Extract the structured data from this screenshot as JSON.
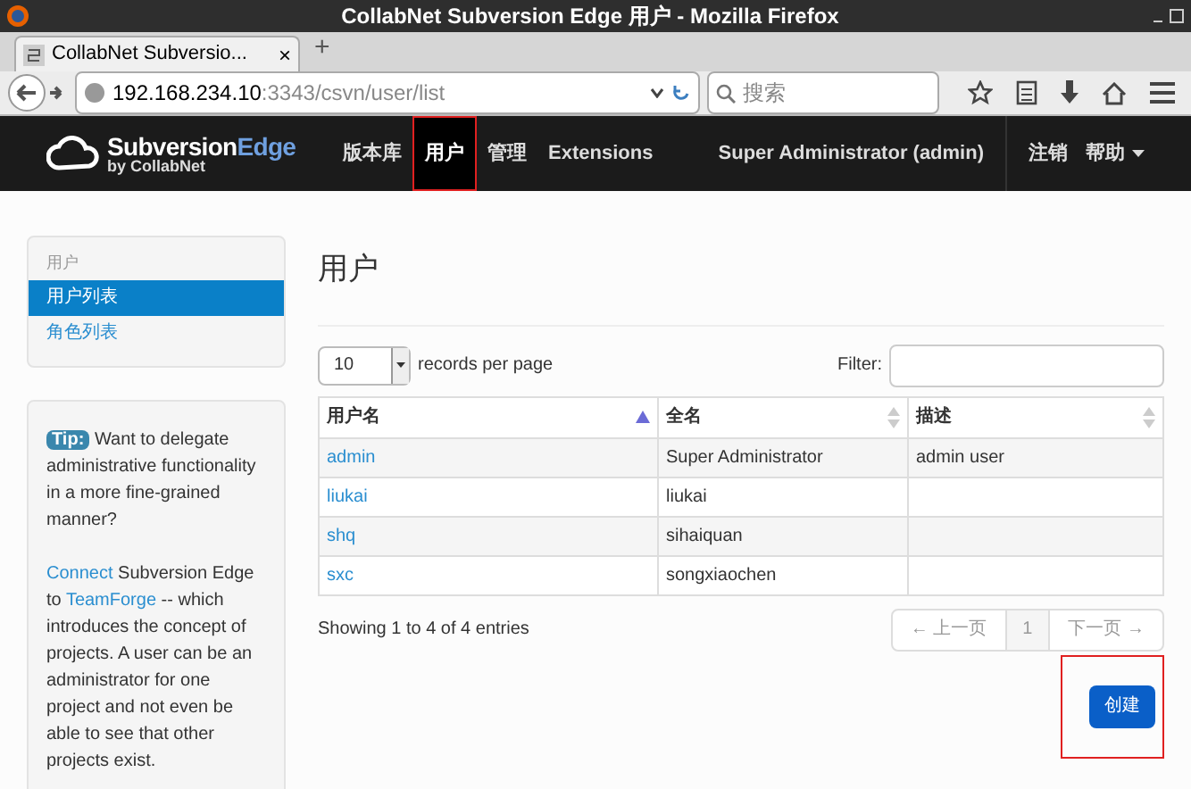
{
  "window": {
    "title": "CollabNet Subversion Edge 用户 - Mozilla Firefox"
  },
  "browser": {
    "tab_title": "CollabNet Subversio...",
    "tab_close": "×",
    "new_tab": "+",
    "url_host": "192.168.234.10",
    "url_path": ":3343/csvn/user/list",
    "search_placeholder": "搜索"
  },
  "app_nav": {
    "logo_main": "Subversion",
    "logo_accent": "Edge",
    "logo_sub": "by CollabNet",
    "items": [
      {
        "label": "版本库",
        "selected": false,
        "annotated": false
      },
      {
        "label": "用户",
        "selected": true,
        "annotated": true
      },
      {
        "label": "管理",
        "selected": false,
        "annotated": false
      },
      {
        "label": "Extensions",
        "selected": false,
        "annotated": false
      }
    ],
    "user": "Super Administrator (admin)",
    "logout": "注销",
    "help": "帮助"
  },
  "sidebar": {
    "heading": "用户",
    "items": [
      {
        "label": "用户列表",
        "selected": true
      },
      {
        "label": "角色列表",
        "selected": false
      }
    ]
  },
  "tip": {
    "badge": "Tip:",
    "question": "Want to delegate administrative functionality in a more fine-grained manner?",
    "link1": "Connect",
    "text1": " Subversion Edge to ",
    "link2": "TeamForge",
    "text2": " -- which introduces the concept of projects. A user can be an administrator for one project and not even be able to see that other projects exist."
  },
  "page_title": "用户",
  "table": {
    "page_size": "10",
    "page_size_label": "records per page",
    "filter_label": "Filter:",
    "columns": [
      {
        "label": "用户名",
        "sorted": true
      },
      {
        "label": "全名",
        "sorted": false
      },
      {
        "label": "描述",
        "sorted": false
      }
    ],
    "rows": [
      [
        "admin",
        "Super Administrator",
        "admin user"
      ],
      [
        "liukai",
        "liukai",
        ""
      ],
      [
        "shq",
        "sihaiquan",
        ""
      ],
      [
        "sxc",
        "songxiaochen",
        ""
      ]
    ],
    "info": "Showing 1 to 4 of 4 entries",
    "prev": "← 上一页",
    "page": "1",
    "next": "下一页 →"
  },
  "create_button": {
    "label": "创建",
    "annotated": true
  }
}
